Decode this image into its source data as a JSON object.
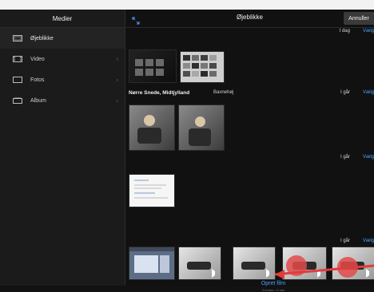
{
  "sidebar": {
    "header": "Medier",
    "items": [
      {
        "label": "Øjeblikke",
        "icon": "moments-icon",
        "active": true,
        "has_chevron": false
      },
      {
        "label": "Video",
        "icon": "video-icon",
        "active": false,
        "has_chevron": true
      },
      {
        "label": "Fotos",
        "icon": "photos-icon",
        "active": false,
        "has_chevron": true
      },
      {
        "label": "Album",
        "icon": "album-icon",
        "active": false,
        "has_chevron": true
      }
    ]
  },
  "main": {
    "header": {
      "title": "Øjeblikke",
      "cancel_label": "Annuller",
      "expand_icon": "expand-icon"
    },
    "sections": [
      {
        "date": "I dag",
        "action": "Vælg"
      },
      {
        "date": "I går",
        "action": "Vælg",
        "location": "Nørre Snede, Midtjylland",
        "sublocation": "Bavnehøj"
      },
      {
        "date": "I går",
        "action": "Vælg"
      },
      {
        "date": "I går",
        "action": "Vælg"
      }
    ],
    "create_film": "Opret film",
    "create_film_subtext": "0 emner • 0 min"
  },
  "colors": {
    "accent": "#4aa3ff",
    "highlight": "#e24a4a"
  }
}
